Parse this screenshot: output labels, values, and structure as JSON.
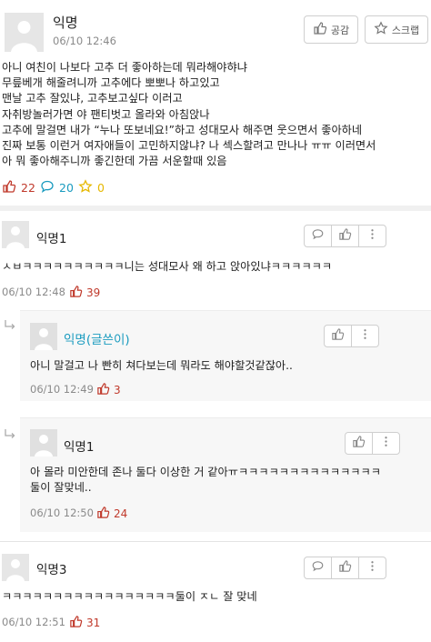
{
  "post": {
    "author": "익명",
    "time": "06/10 12:46",
    "like_button": "공감",
    "scrap_button": "스크랩",
    "body_lines": [
      "아니 여친이 나보다 고추 더 좋아하는데 뭐라해야햐냐",
      "무릎베개 해줄려니까 고추에다 뽀뽀나 하고있고",
      "맨날 고추 잘있냐, 고추보고싶다 이러고",
      "자취방놀러가면 야 팬티벗고 올라와 아침앉나",
      "고추에 말걸면 내가 “누나 또보네요!”하고 성대모사 해주면 웃으면서 좋아하네",
      "진짜 보통 이런거 여자애들이 고민하지않냐? 나 섹스할려고 만나나 ㅠㅠ 이러면서",
      "아 뭐 좋아해주니까 좋긴한데 가끔 서운할때 있음"
    ],
    "likes": "22",
    "comments": "20",
    "scraps": "0"
  },
  "comments": [
    {
      "author": "익명1",
      "lines": [
        "ㅅㅂㅋㅋㅋㅋㅋㅋㅋㅋㅋㅋ니는 성대모사 왜 하고 앉아있냐ㅋㅋㅋㅋㅋㅋ"
      ],
      "time": "06/10 12:48",
      "likes": "39"
    },
    {
      "author": "익명(글쓴이)",
      "lines": [
        "아니 말걸고 나 빤히 쳐다보는데 뭐라도 해야할것같잖아.."
      ],
      "time": "06/10 12:49",
      "likes": "3"
    },
    {
      "author": "익명1",
      "lines": [
        "아 몰라 미안한데 존나 둘다 이상한 거 같아ㅠㅋㅋㅋㅋㅋㅋㅋㅋㅋㅋㅋㅋㅋㅋ",
        "둘이 잘맞네.."
      ],
      "time": "06/10 12:50",
      "likes": "24"
    },
    {
      "author": "익명3",
      "lines": [
        "ㅋㅋㅋㅋㅋㅋㅋㅋㅋㅋㅋㅋㅋㅋㅋㅋㅋ둘이 ㅈㄴ 잘 맞네"
      ],
      "time": "06/10 12:51",
      "likes": "31"
    }
  ],
  "colors": {
    "like": "#c0392b",
    "comment": "#1a9bbf",
    "scrap": "#e6b800",
    "author_op": "#1a9bbf"
  }
}
